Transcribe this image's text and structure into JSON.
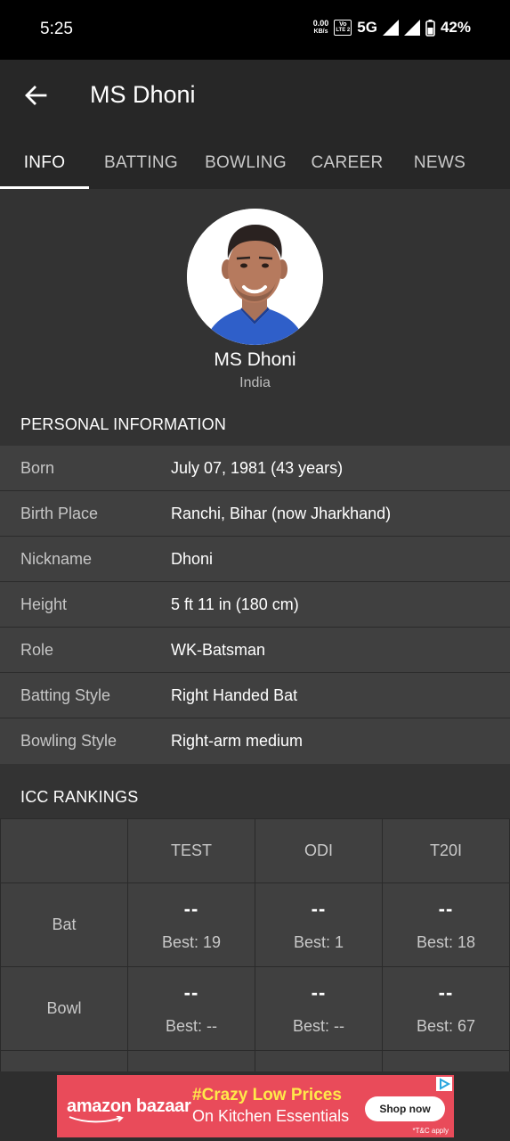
{
  "status": {
    "time": "5:25",
    "net_speed_value": "0.00",
    "net_speed_unit": "KB/s",
    "volte_top": "Vo",
    "volte_bottom": "LTE 2",
    "network": "5G",
    "battery": "42%"
  },
  "header": {
    "title": "MS Dhoni",
    "back_icon": "arrow-left-icon"
  },
  "tabs": [
    {
      "label": "INFO",
      "active": true
    },
    {
      "label": "BATTING",
      "active": false
    },
    {
      "label": "BOWLING",
      "active": false
    },
    {
      "label": "CAREER",
      "active": false
    },
    {
      "label": "NEWS",
      "active": false
    }
  ],
  "profile": {
    "name": "MS Dhoni",
    "country": "India"
  },
  "personal_info": {
    "heading": "PERSONAL INFORMATION",
    "rows": [
      {
        "label": "Born",
        "value": "July 07, 1981 (43 years)"
      },
      {
        "label": "Birth Place",
        "value": "Ranchi, Bihar (now Jharkhand)"
      },
      {
        "label": "Nickname",
        "value": "Dhoni"
      },
      {
        "label": "Height",
        "value": "5 ft 11 in (180 cm)"
      },
      {
        "label": "Role",
        "value": "WK-Batsman"
      },
      {
        "label": "Batting Style",
        "value": "Right Handed Bat"
      },
      {
        "label": "Bowling Style",
        "value": "Right-arm medium"
      }
    ]
  },
  "icc_rankings": {
    "heading": "ICC RANKINGS",
    "columns": [
      "TEST",
      "ODI",
      "T20I"
    ],
    "rows": [
      {
        "label": "Bat",
        "cells": [
          {
            "current": "--",
            "best": "Best: 19"
          },
          {
            "current": "--",
            "best": "Best: 1"
          },
          {
            "current": "--",
            "best": "Best: 18"
          }
        ]
      },
      {
        "label": "Bowl",
        "cells": [
          {
            "current": "--",
            "best": "Best: --"
          },
          {
            "current": "--",
            "best": "Best: --"
          },
          {
            "current": "--",
            "best": "Best: 67"
          }
        ]
      }
    ]
  },
  "ad": {
    "brand": "amazon bazaar",
    "headline": "#Crazy Low Prices",
    "subline": "On Kitchen Essentials",
    "cta": "Shop now",
    "terms": "*T&C apply",
    "background": "#e94b5a"
  },
  "colors": {
    "app_bar": "#272727",
    "page_bg": "#333333",
    "row_bg": "#404040",
    "status_bar": "#000000"
  }
}
